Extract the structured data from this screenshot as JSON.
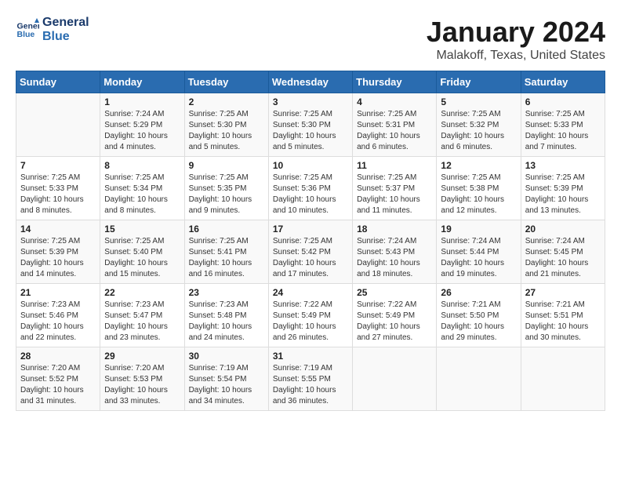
{
  "logo": {
    "line1": "General",
    "line2": "Blue"
  },
  "title": "January 2024",
  "subtitle": "Malakoff, Texas, United States",
  "weekdays": [
    "Sunday",
    "Monday",
    "Tuesday",
    "Wednesday",
    "Thursday",
    "Friday",
    "Saturday"
  ],
  "weeks": [
    [
      {
        "day": "",
        "info": ""
      },
      {
        "day": "1",
        "info": "Sunrise: 7:24 AM\nSunset: 5:29 PM\nDaylight: 10 hours\nand 4 minutes."
      },
      {
        "day": "2",
        "info": "Sunrise: 7:25 AM\nSunset: 5:30 PM\nDaylight: 10 hours\nand 5 minutes."
      },
      {
        "day": "3",
        "info": "Sunrise: 7:25 AM\nSunset: 5:30 PM\nDaylight: 10 hours\nand 5 minutes."
      },
      {
        "day": "4",
        "info": "Sunrise: 7:25 AM\nSunset: 5:31 PM\nDaylight: 10 hours\nand 6 minutes."
      },
      {
        "day": "5",
        "info": "Sunrise: 7:25 AM\nSunset: 5:32 PM\nDaylight: 10 hours\nand 6 minutes."
      },
      {
        "day": "6",
        "info": "Sunrise: 7:25 AM\nSunset: 5:33 PM\nDaylight: 10 hours\nand 7 minutes."
      }
    ],
    [
      {
        "day": "7",
        "info": "Sunrise: 7:25 AM\nSunset: 5:33 PM\nDaylight: 10 hours\nand 8 minutes."
      },
      {
        "day": "8",
        "info": "Sunrise: 7:25 AM\nSunset: 5:34 PM\nDaylight: 10 hours\nand 8 minutes."
      },
      {
        "day": "9",
        "info": "Sunrise: 7:25 AM\nSunset: 5:35 PM\nDaylight: 10 hours\nand 9 minutes."
      },
      {
        "day": "10",
        "info": "Sunrise: 7:25 AM\nSunset: 5:36 PM\nDaylight: 10 hours\nand 10 minutes."
      },
      {
        "day": "11",
        "info": "Sunrise: 7:25 AM\nSunset: 5:37 PM\nDaylight: 10 hours\nand 11 minutes."
      },
      {
        "day": "12",
        "info": "Sunrise: 7:25 AM\nSunset: 5:38 PM\nDaylight: 10 hours\nand 12 minutes."
      },
      {
        "day": "13",
        "info": "Sunrise: 7:25 AM\nSunset: 5:39 PM\nDaylight: 10 hours\nand 13 minutes."
      }
    ],
    [
      {
        "day": "14",
        "info": "Sunrise: 7:25 AM\nSunset: 5:39 PM\nDaylight: 10 hours\nand 14 minutes."
      },
      {
        "day": "15",
        "info": "Sunrise: 7:25 AM\nSunset: 5:40 PM\nDaylight: 10 hours\nand 15 minutes."
      },
      {
        "day": "16",
        "info": "Sunrise: 7:25 AM\nSunset: 5:41 PM\nDaylight: 10 hours\nand 16 minutes."
      },
      {
        "day": "17",
        "info": "Sunrise: 7:25 AM\nSunset: 5:42 PM\nDaylight: 10 hours\nand 17 minutes."
      },
      {
        "day": "18",
        "info": "Sunrise: 7:24 AM\nSunset: 5:43 PM\nDaylight: 10 hours\nand 18 minutes."
      },
      {
        "day": "19",
        "info": "Sunrise: 7:24 AM\nSunset: 5:44 PM\nDaylight: 10 hours\nand 19 minutes."
      },
      {
        "day": "20",
        "info": "Sunrise: 7:24 AM\nSunset: 5:45 PM\nDaylight: 10 hours\nand 21 minutes."
      }
    ],
    [
      {
        "day": "21",
        "info": "Sunrise: 7:23 AM\nSunset: 5:46 PM\nDaylight: 10 hours\nand 22 minutes."
      },
      {
        "day": "22",
        "info": "Sunrise: 7:23 AM\nSunset: 5:47 PM\nDaylight: 10 hours\nand 23 minutes."
      },
      {
        "day": "23",
        "info": "Sunrise: 7:23 AM\nSunset: 5:48 PM\nDaylight: 10 hours\nand 24 minutes."
      },
      {
        "day": "24",
        "info": "Sunrise: 7:22 AM\nSunset: 5:49 PM\nDaylight: 10 hours\nand 26 minutes."
      },
      {
        "day": "25",
        "info": "Sunrise: 7:22 AM\nSunset: 5:49 PM\nDaylight: 10 hours\nand 27 minutes."
      },
      {
        "day": "26",
        "info": "Sunrise: 7:21 AM\nSunset: 5:50 PM\nDaylight: 10 hours\nand 29 minutes."
      },
      {
        "day": "27",
        "info": "Sunrise: 7:21 AM\nSunset: 5:51 PM\nDaylight: 10 hours\nand 30 minutes."
      }
    ],
    [
      {
        "day": "28",
        "info": "Sunrise: 7:20 AM\nSunset: 5:52 PM\nDaylight: 10 hours\nand 31 minutes."
      },
      {
        "day": "29",
        "info": "Sunrise: 7:20 AM\nSunset: 5:53 PM\nDaylight: 10 hours\nand 33 minutes."
      },
      {
        "day": "30",
        "info": "Sunrise: 7:19 AM\nSunset: 5:54 PM\nDaylight: 10 hours\nand 34 minutes."
      },
      {
        "day": "31",
        "info": "Sunrise: 7:19 AM\nSunset: 5:55 PM\nDaylight: 10 hours\nand 36 minutes."
      },
      {
        "day": "",
        "info": ""
      },
      {
        "day": "",
        "info": ""
      },
      {
        "day": "",
        "info": ""
      }
    ]
  ]
}
